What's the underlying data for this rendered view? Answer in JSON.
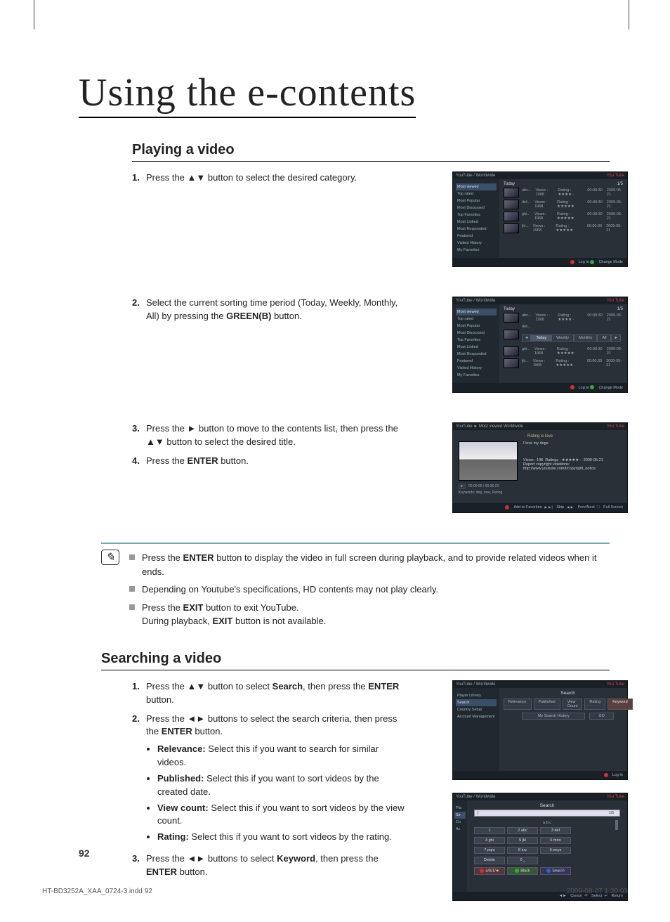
{
  "title": "Using the e-contents",
  "section_play": "Playing a video",
  "section_search": "Searching a video",
  "play": {
    "s1": {
      "n": "1.",
      "t": "Press the ▲▼ button to select the desired category."
    },
    "s2": {
      "n": "2.",
      "t_a": "Select the current sorting time period (Today, Weekly, Monthly, All) by pressing the ",
      "t_b": "GREEN(B)",
      "t_c": " button."
    },
    "s3": {
      "n": "3.",
      "t": "Press the ►  button to move to the contents list, then press the ▲▼ button to select the desired title."
    },
    "s4": {
      "n": "4.",
      "t_a": "Press the ",
      "t_b": "ENTER",
      "t_c": " button."
    }
  },
  "notes": {
    "n1_a": "Press the ",
    "n1_b": "ENTER",
    "n1_c": " button to display the video in full screen during playback, and to provide related videos when it ends.",
    "n2": "Depending on Youtube's specifications, HD contents may not play clearly.",
    "n3_a": "Press the ",
    "n3_b": "EXIT",
    "n3_c": " button to exit YouTube.",
    "n3_d": "During playback, ",
    "n3_e": "EXIT",
    "n3_f": " button is not available."
  },
  "search": {
    "s1": {
      "n": "1.",
      "a": "Press the ▲▼ button to select ",
      "b": "Search",
      "c": ", then press the ",
      "d": "ENTER",
      "e": " button."
    },
    "s2": {
      "n": "2.",
      "a": "Press the ◄► buttons to select the search criteria, then press the ",
      "b": "ENTER",
      "c": " button."
    },
    "b_rel_t": "Relevance:",
    "b_rel": " Select this if you want to search for similar videos.",
    "b_pub_t": "Published:",
    "b_pub": " Select this if you want to sort videos by the created date.",
    "b_vc_t": "View count:",
    "b_vc": " Select this if you want to sort videos by the view count.",
    "b_rat_t": "Rating:",
    "b_rat": " Select this if you want to sort videos by the rating.",
    "s3": {
      "n": "3.",
      "a": "Press the ◄► buttons to select ",
      "b": "Keyword",
      "c": ", then press the ",
      "d": "ENTER",
      "e": " button."
    }
  },
  "ss_common": {
    "hdr": "YouTube /    Worldwide",
    "logo": "You Tube",
    "today": "Today",
    "page": "1/5",
    "login": "Log In",
    "change": "Change Mode",
    "addfav": "Add to Favorites",
    "skip": "Skip",
    "prevnext": "Prev/Next",
    "fullscr": "Full Screen",
    "cursor": "Cursor",
    "select": "Select",
    "return": "Return"
  },
  "sidebar_items": [
    "Most viewed",
    "Top rated",
    "Most Popular",
    "Most Discussed",
    "Top Favorites",
    "Most Linked",
    "Most Responded",
    "Featured",
    "Visited History",
    "My Favorites"
  ],
  "videos": [
    {
      "t": "abc...",
      "v": "Views : 1968",
      "r": "Rating : ★★★★ -",
      "d": "00:00:30",
      "dt": "2009-05-21"
    },
    {
      "t": "def...",
      "v": "Views : 1968",
      "r": "Rating : ★★★★★",
      "d": "00:00:30",
      "dt": "2009-05-21"
    },
    {
      "t": "ghi...",
      "v": "Views : 1968",
      "r": "Rating : ★★★★★",
      "d": "00:00:30",
      "dt": "2009-05-21"
    },
    {
      "t": "jkl...",
      "v": "Views : 1968",
      "r": "Rating : ★★★★★",
      "d": "00:00:30",
      "dt": "2009-05-21"
    }
  ],
  "tabs": [
    "Today",
    "Weekly",
    "Monthly",
    "All"
  ],
  "detail": {
    "hdr": "YouTube ► Most viewed      Worldwide",
    "title": "Rating is love",
    "desc": "I love my dogs.",
    "views": "Views : 196",
    "rating": "Ratings : ★★★★★ -",
    "date": "2009-05-21",
    "note1": "Report copyright violations:",
    "note2": "http://www.youtube.com/t/copyright_notice",
    "time": "00:00:00 / 00:36:23",
    "kw": "Keywords: dog, love, Rating"
  },
  "search_ss": {
    "title": "Search",
    "sidebar": [
      "Player Library",
      "Search",
      "Country Setup",
      "Account Management"
    ],
    "tabs": [
      "Relevance",
      "Published",
      "View Count",
      "Rating",
      "Keyword"
    ],
    "hist": "My Search History",
    "go": "GO"
  },
  "kbd_ss": {
    "title": "Search",
    "input_hint": "a b c",
    "sidecut": [
      "Pla",
      "Se",
      "Co",
      "Ac"
    ],
    "keys_r1": [
      "1",
      "2 abc",
      "3 def"
    ],
    "keys_r2": [
      "4 ghi",
      "5 jkl",
      "6 mno"
    ],
    "keys_r3": [
      "7 pqrs",
      "8 tuv",
      "9 wxyz"
    ],
    "keys_r4": [
      "Delete",
      "0 ⎵",
      ""
    ],
    "ftr_a": "a/A/1/★",
    "ftr_b": "Black",
    "ftr_d": "Search"
  },
  "page_num": "92",
  "foot_l": "HT-BD3252A_XAA_0724-3.indd   92",
  "foot_r": "2009-08-07   1:20:03"
}
